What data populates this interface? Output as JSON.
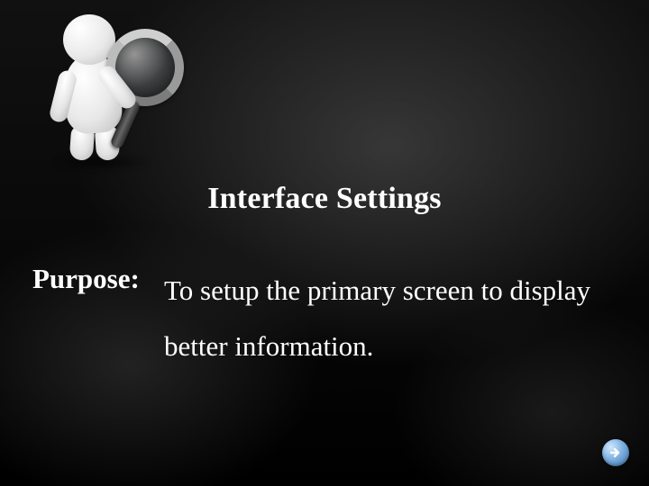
{
  "title": "Interface Settings",
  "label": "Purpose:",
  "description": "To setup the primary screen to display better information.",
  "nextButton": {
    "name": "Next"
  }
}
